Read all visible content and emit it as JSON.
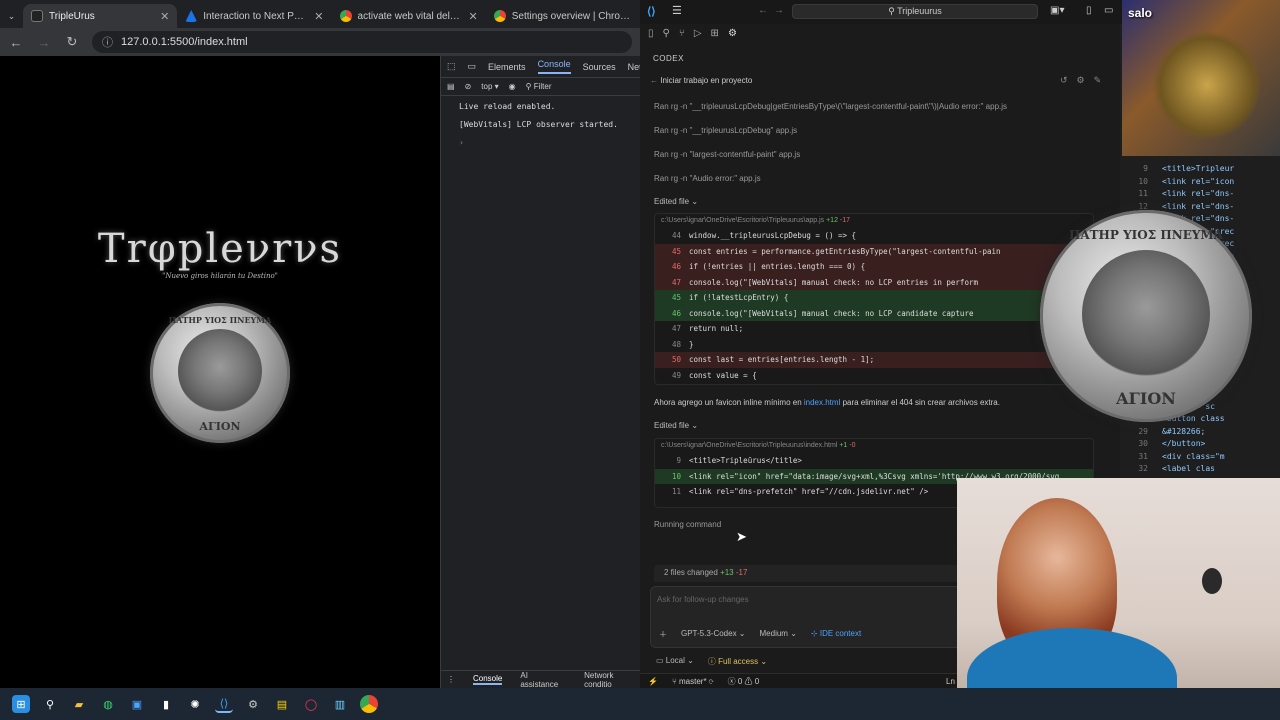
{
  "browser": {
    "tabs": [
      {
        "title": "TripleUrus",
        "icon": "tripleurus-favicon",
        "active": true
      },
      {
        "title": "Interaction to Next Paint (INP)",
        "icon": "web-dev-icon"
      },
      {
        "title": "activate web vital deltools - Bu",
        "icon": "chrome-icon"
      },
      {
        "title": "Settings overview | Chrome D",
        "icon": "chrome-icon"
      }
    ],
    "url": "127.0.0.1:5500/index.html"
  },
  "site": {
    "title": "Trφpleνrνs",
    "subtitle": "\"Nuevo giros hilarán tu Destino\"",
    "coin_top": "ΠΑΤΗΡ ΥΙΟΣ ΠΝΕΥΜΑ",
    "coin_bottom": "ΑΓΙΟΝ"
  },
  "devtools": {
    "tabs": [
      "Elements",
      "Console",
      "Sources",
      "Netw"
    ],
    "active_tab": "Console",
    "context": "top",
    "filter_placeholder": "Filter",
    "logs": [
      "Live reload enabled.",
      "[WebVitals] LCP observer started."
    ],
    "bottom_tabs": [
      "Console",
      "AI assistance",
      "Network conditio"
    ]
  },
  "vscode": {
    "search": "Tripleuurus",
    "panel_title": "CODEX",
    "task_title": "Iniciar trabajo en proyecto",
    "ran_commands": [
      "Ran rg -n \"__tripleurusLcpDebug|getEntriesByType\\(\\\"largest-contentful-paint\\\"\\)|Audio error:\" app.js",
      "Ran rg -n \"__tripleurusLcpDebug\" app.js",
      "Ran rg -n \"largest-contentful-paint\" app.js",
      "Ran rg -n \"Audio error:\" app.js"
    ],
    "edited_label": "Edited file",
    "file1": {
      "path": "c:\\Users\\ignar\\OneDrive\\Escritorio\\Tripleuurus\\app.js",
      "added": "+12",
      "removed": "-17",
      "lines": [
        {
          "n": "44",
          "type": "ctx",
          "code": "    window.__tripleurusLcpDebug = () => {"
        },
        {
          "n": "45",
          "type": "del",
          "code": "      const entries = performance.getEntriesByType(\"largest-contentful-pain"
        },
        {
          "n": "46",
          "type": "del",
          "code": "      if (!entries || entries.length === 0) {"
        },
        {
          "n": "47",
          "type": "del",
          "code": "        console.log(\"[WebVitals] manual check: no LCP entries in perform"
        },
        {
          "n": "45",
          "type": "add",
          "code": "      if (!latestLcpEntry) {"
        },
        {
          "n": "46",
          "type": "add",
          "code": "        console.log(\"[WebVitals] manual check: no LCP candidate capture"
        },
        {
          "n": "47",
          "type": "ctx",
          "code": "        return null;"
        },
        {
          "n": "48",
          "type": "ctx",
          "code": "      }"
        },
        {
          "n": "50",
          "type": "del",
          "code": "      const last = entries[entries.length - 1];"
        },
        {
          "n": "49",
          "type": "ctx",
          "code": "      const value = {"
        }
      ]
    },
    "message_pre": "Ahora agrego un favicon inline mínimo en ",
    "message_link": "index.html",
    "message_post": " para eliminar el 404 sin crear archivos extra.",
    "file2": {
      "path": "c:\\Users\\ignar\\OneDrive\\Escritorio\\Tripleuurus\\index.html",
      "added": "+1",
      "removed": "-0",
      "lines": [
        {
          "n": "9",
          "type": "ctx",
          "code": "    <title>Tripleūrus</title>"
        },
        {
          "n": "10",
          "type": "add",
          "code": "    <link rel=\"icon\" href=\"data:image/svg+xml,%3Csvg xmlns='http://www.w3.org/2000/svg"
        },
        {
          "n": "11",
          "type": "ctx",
          "code": "    <link rel=\"dns-prefetch\" href=\"//cdn.jsdelivr.net\" />"
        }
      ]
    },
    "running": "Running command",
    "files_changed": "2 files changed",
    "files_added": "+13",
    "files_removed": "-17",
    "input_placeholder": "Ask for follow-up changes",
    "model": "GPT-5.3-Codex",
    "effort": "Medium",
    "ide_context": "IDE context",
    "env": "Local",
    "access": "Full access",
    "branch": "master*",
    "errors": "0",
    "warnings": "0",
    "right_lines": [
      {
        "n": "9",
        "code": "<title>Tripleur"
      },
      {
        "n": "10",
        "code": "<link rel=\"icon"
      },
      {
        "n": "11",
        "code": "<link rel=\"dns-"
      },
      {
        "n": "12",
        "code": "<link rel=\"dns-"
      },
      {
        "n": "13",
        "code": "<link rel=\"dns-"
      },
      {
        "n": "14",
        "code": "<link rel=\"prec"
      },
      {
        "n": "15",
        "code": "<link rel=\"prec"
      },
      {
        "n": "16",
        "code": "<link rel=\"prec"
      }
    ],
    "right_lines_bottom": [
      {
        "n": "26",
        "code": "class=\"vel"
      },
      {
        "n": "27",
        "code": "v class=\"sc"
      },
      {
        "n": "28",
        "code": "<button class"
      },
      {
        "n": "29",
        "code": "  &#128266;"
      },
      {
        "n": "30",
        "code": "</button>"
      },
      {
        "n": "31",
        "code": "<div class=\"m"
      },
      {
        "n": "32",
        "code": "  <label clas"
      },
      {
        "n": "33",
        "code": ""
      }
    ],
    "status_right": "Ln"
  },
  "webcam_label": "salo"
}
